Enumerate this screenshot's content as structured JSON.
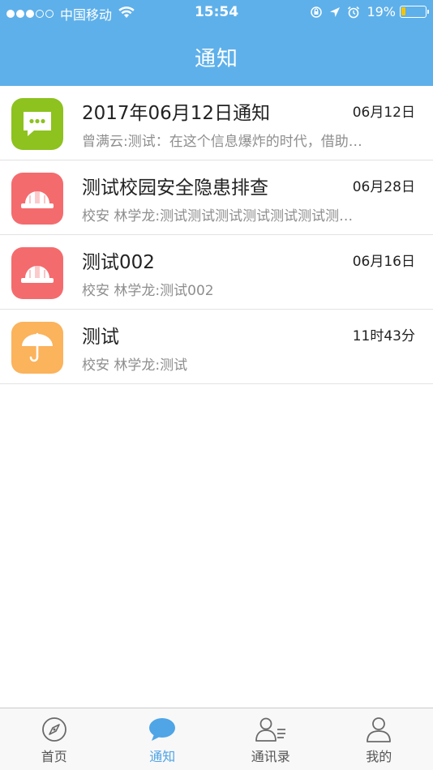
{
  "status_bar": {
    "carrier": "中国移动",
    "time": "15:54",
    "battery_percent": "19%",
    "battery_level": 0.19,
    "signal_bars_filled": 3,
    "signal_bars_total": 5
  },
  "nav": {
    "title": "通知"
  },
  "notifications": [
    {
      "title": "2017年06月12日通知",
      "date": "06月12日",
      "subtitle": "曾满云:测试：在这个信息爆炸的时代，借助…",
      "icon": "chat-bubble-icon",
      "icon_color": "#8dc21f"
    },
    {
      "title": "测试校园安全隐患排查",
      "date": "06月28日",
      "subtitle": "校安 林学龙:测试测试测试测试测试测试测…",
      "icon": "hard-hat-icon",
      "icon_color": "#f46b6e"
    },
    {
      "title": "测试002",
      "date": "06月16日",
      "subtitle": "校安 林学龙:测试002",
      "icon": "hard-hat-icon",
      "icon_color": "#f46b6e"
    },
    {
      "title": "测试",
      "date": "11时43分",
      "subtitle": "校安 林学龙:测试",
      "icon": "umbrella-icon",
      "icon_color": "#fbb35c"
    }
  ],
  "tabs": [
    {
      "label": "首页",
      "icon": "compass-icon",
      "active": false
    },
    {
      "label": "通知",
      "icon": "chat-bubble-icon",
      "active": true
    },
    {
      "label": "通讯录",
      "icon": "contacts-icon",
      "active": false
    },
    {
      "label": "我的",
      "icon": "person-icon",
      "active": false
    }
  ],
  "colors": {
    "header": "#5eb0ea",
    "accent": "#4fa5e6",
    "tab_inactive": "#555555"
  }
}
